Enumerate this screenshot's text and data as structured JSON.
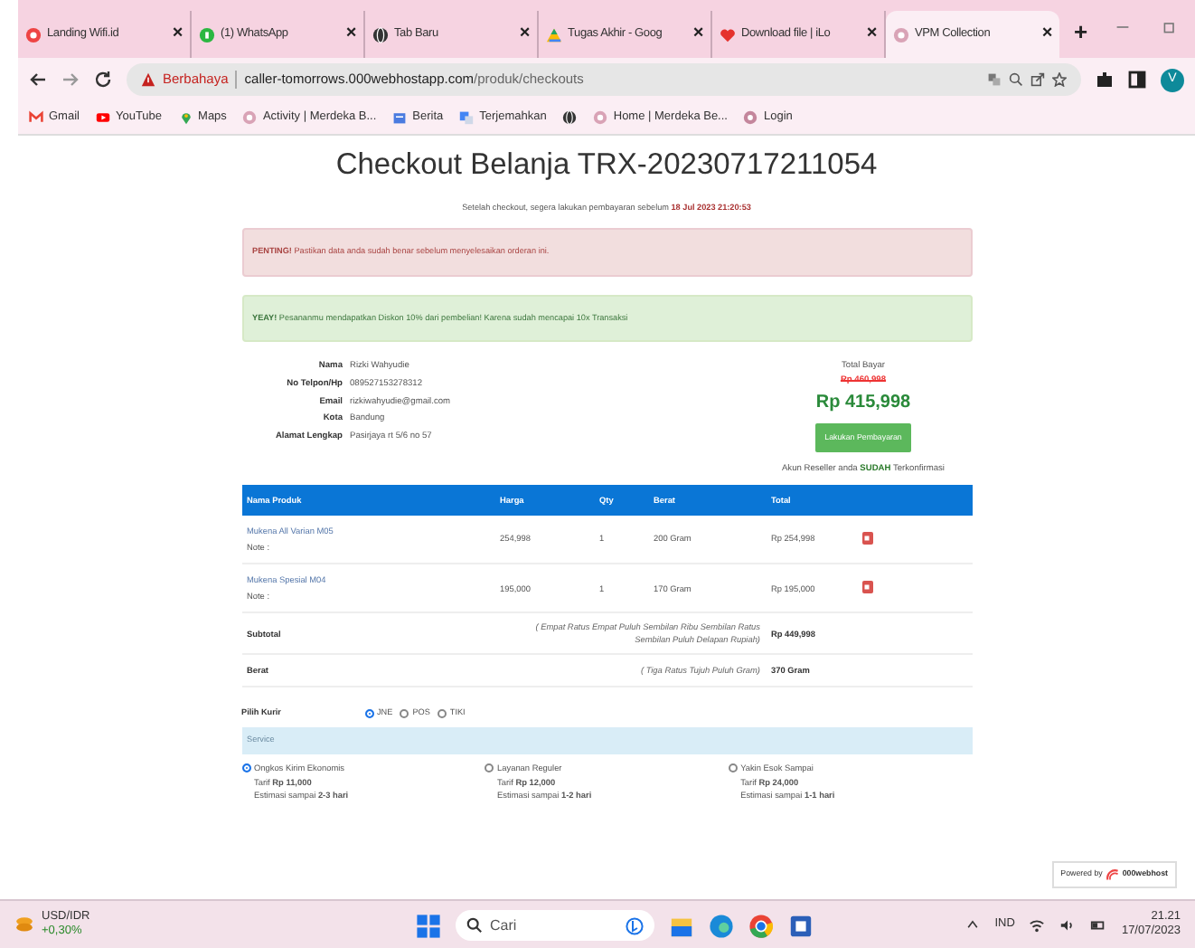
{
  "browser": {
    "tabs": [
      {
        "title": "Landing Wifi.id",
        "selected": false
      },
      {
        "title": "(1) WhatsApp",
        "selected": false
      },
      {
        "title": "Tab Baru",
        "selected": false
      },
      {
        "title": "Tugas Akhir - Goog",
        "selected": false
      },
      {
        "title": "Download file | iLo",
        "selected": false
      },
      {
        "title": "VPM Collection",
        "selected": true
      }
    ],
    "new_tab": "+",
    "close": "×",
    "address": {
      "warning": "Berbahaya",
      "host": "caller-tomorrows.000webhostapp.com",
      "path": "/produk/checkouts"
    },
    "profile": "V",
    "bookmarks": [
      {
        "label": "Gmail"
      },
      {
        "label": "YouTube"
      },
      {
        "label": "Maps"
      },
      {
        "label": "Activity | Merdeka B..."
      },
      {
        "label": "Berita"
      },
      {
        "label": "Terjemahkan"
      },
      {
        "label": "Home | Merdeka Be..."
      },
      {
        "label": "Login"
      }
    ]
  },
  "page": {
    "title": "Checkout Belanja TRX-20230717211054",
    "deadline": "Setelah checkout, segera lakukan pembayaran sebelum **18 Jul 2023 21:20:53**",
    "alerts": [
      {
        "kind": "danger",
        "text": "**PENTING!** Pastikan data anda sudah benar sebelum menyelesaikan orderan ini."
      },
      {
        "kind": "success",
        "text": "**YEAY!** Pesananmu mendapatkan Diskon 10% dari pembelian! Karena sudah mencapai 10x Transaksi"
      }
    ],
    "customer": [
      {
        "label": "Nama",
        "value": "Rizki Wahyudie"
      },
      {
        "label": "No Telpon/Hp",
        "value": "089527153278312"
      },
      {
        "label": "Email",
        "value": "rizkiwahyudie@gmail.com"
      },
      {
        "label": "Kota",
        "value": "Bandung"
      },
      {
        "label": "Alamat Lengkap",
        "value": "Pasirjaya rt 5/6 no 57"
      }
    ],
    "total": {
      "label": "Total Bayar",
      "original": "Rp 460,998",
      "amount": "Rp 415,998",
      "button": "Lakukan Pembayaran",
      "note": "Akun Reseller anda **SUDAH** Terkonfirmasi"
    },
    "table": {
      "columns": [
        "Nama Produk",
        "Harga",
        "Qty",
        "Berat",
        "Total"
      ],
      "rows": [
        {
          "product": "Mukena All Varian M05",
          "note": "Note :",
          "price": "254,998",
          "qty": "1",
          "weight": "200 Gram",
          "total": "Rp 254,998"
        },
        {
          "product": "Mukena Spesial M04",
          "note": "Note :",
          "price": "195,000",
          "qty": "1",
          "weight": "170 Gram",
          "total": "Rp 195,000"
        }
      ],
      "summary": [
        {
          "label": "Subtotal",
          "words": "( Empat Ratus Empat Puluh Sembilan Ribu Sembilan Ratus Sembilan Puluh Delapan Rupiah)",
          "value": "Rp 449,998"
        },
        {
          "label": "Berat",
          "words": "( Tiga Ratus Tujuh Puluh Gram)",
          "value": "370 Gram"
        }
      ]
    },
    "courier": {
      "label": "Pilih Kurir",
      "options": [
        {
          "label": "JNE",
          "selected": true
        },
        {
          "label": "POS",
          "selected": false
        },
        {
          "label": "TIKI",
          "selected": false
        }
      ]
    },
    "service": {
      "title": "Service",
      "options": [
        {
          "name": "Ongkos Kirim Ekonomis",
          "tariff": "Tarif **Rp 11,000**",
          "estimate": "Estimasi sampai **2-3 hari**",
          "selected": true
        },
        {
          "name": "Layanan Reguler",
          "tariff": "Tarif **Rp 12,000**",
          "estimate": "Estimasi sampai **1-2 hari**",
          "selected": false
        },
        {
          "name": "Yakin Esok Sampai",
          "tariff": "Tarif **Rp 24,000**",
          "estimate": "Estimasi sampai **1-1 hari**",
          "selected": false
        }
      ]
    },
    "powered": {
      "prefix": "Powered by",
      "brand": "000webhost"
    }
  },
  "taskbar": {
    "widget": {
      "pair": "USD/IDR",
      "change": "+0,30%"
    },
    "search": {
      "placeholder": "Cari"
    },
    "lang": "IND",
    "time": "21.21",
    "date": "17/07/2023"
  }
}
